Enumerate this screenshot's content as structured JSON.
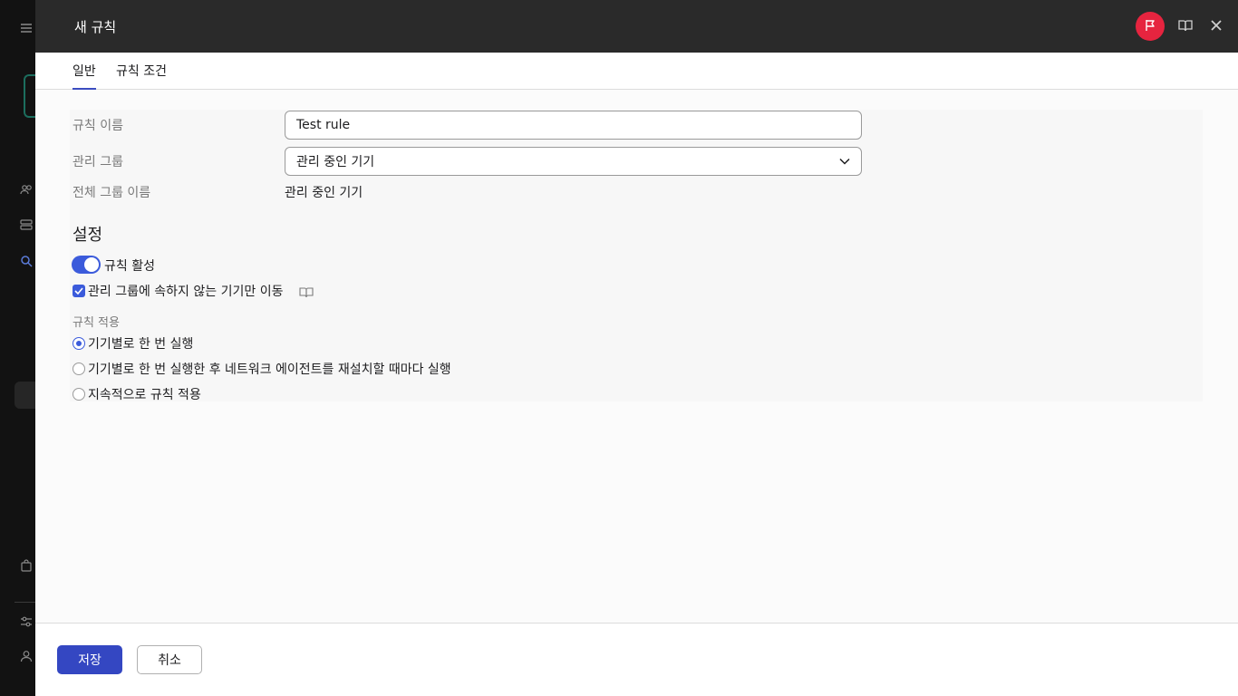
{
  "background_sidebar": {
    "icons": [
      "menu-icon",
      "users-icon",
      "servers-icon",
      "search-icon",
      "bag-icon",
      "sliders-icon",
      "user-icon"
    ]
  },
  "header": {
    "title": "새 규칙",
    "flag_icon": "flag-icon",
    "help_icon": "book-icon",
    "close_icon": "close-icon",
    "accent_color": "#e6243f"
  },
  "tabs": [
    {
      "label": "일반",
      "active": true
    },
    {
      "label": "규칙 조건",
      "active": false
    }
  ],
  "form": {
    "rule_name_label": "규칙 이름",
    "rule_name_value": "Test rule",
    "admin_group_label": "관리 그룹",
    "admin_group_value": "관리 중인 기기",
    "full_group_name_label": "전체 그룹 이름",
    "full_group_name_value": "관리 중인 기기"
  },
  "settings": {
    "title": "설정",
    "rule_active_label": "규칙 활성",
    "rule_active_on": true,
    "move_only_unassigned_label": "관리 그룹에 속하지 않는 기기만 이동",
    "move_only_unassigned_checked": true,
    "apply_label": "규칙 적용",
    "apply_options": [
      {
        "label": "기기별로 한 번 실행",
        "selected": true
      },
      {
        "label": "기기별로 한 번 실행한 후 네트워크 에이전트를 재설치할 때마다 실행",
        "selected": false
      },
      {
        "label": "지속적으로 규칙 적용",
        "selected": false
      }
    ]
  },
  "footer": {
    "save_label": "저장",
    "cancel_label": "취소",
    "primary_color": "#3447c2"
  }
}
